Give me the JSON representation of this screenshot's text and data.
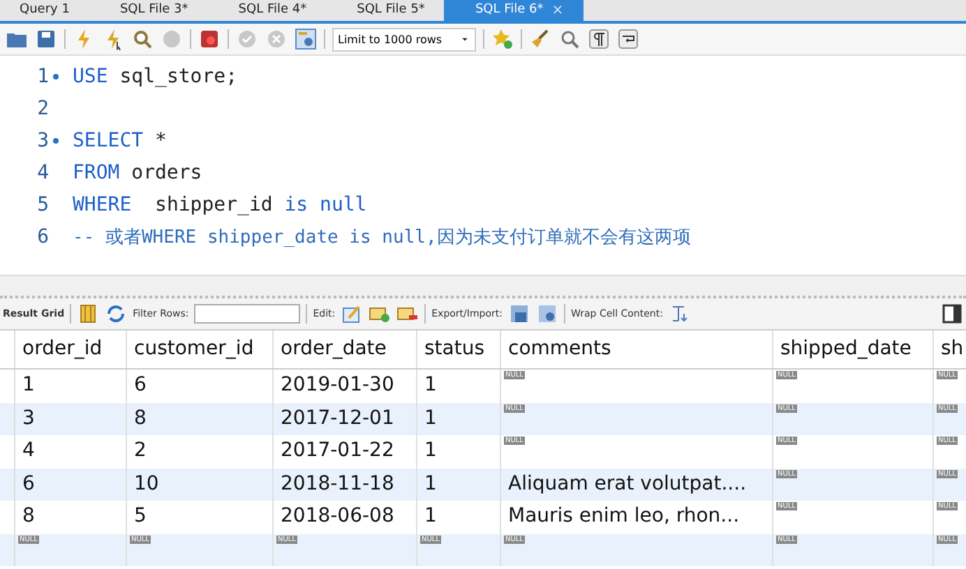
{
  "tabs": [
    {
      "label": "Query 1",
      "selected": false
    },
    {
      "label": "SQL File 3*",
      "selected": false
    },
    {
      "label": "SQL File 4*",
      "selected": false
    },
    {
      "label": "SQL File 5*",
      "selected": false
    },
    {
      "label": "SQL File 6*",
      "selected": true,
      "close": "×"
    }
  ],
  "toolbar": {
    "limit": "Limit to 1000 rows"
  },
  "editor": {
    "lines": [
      {
        "number": "1",
        "fold": true,
        "tokens": [
          {
            "kind": "keyword",
            "text": "USE"
          },
          {
            "kind": "plain",
            "text": " sql_store;"
          }
        ]
      },
      {
        "number": "2",
        "fold": false
      },
      {
        "number": "3",
        "fold": true,
        "tokens": [
          {
            "kind": "keyword",
            "text": "SELECT"
          },
          {
            "kind": "plain",
            "text": " *"
          }
        ]
      },
      {
        "number": "4",
        "fold": false,
        "tokens": [
          {
            "kind": "keyword",
            "text": "FROM"
          },
          {
            "kind": "plain",
            "text": " orders"
          }
        ]
      },
      {
        "number": "5",
        "fold": false,
        "tokens": [
          {
            "kind": "keyword",
            "text": "WHERE"
          },
          {
            "kind": "plain",
            "text": "  shipper_id "
          },
          {
            "kind": "keyword",
            "text": "is null"
          }
        ]
      },
      {
        "number": "6",
        "fold": false,
        "tokens": [
          {
            "kind": "comment",
            "text": "-- 或者WHERE shipper_date is null,因为未支付订单就不会有这两项"
          }
        ]
      }
    ]
  },
  "result_toolbar": {
    "result_grid": "Result Grid",
    "filter_label": "Filter Rows:",
    "edit_label": "Edit:",
    "export_label": "Export/Import:",
    "wrap_label": "Wrap Cell Content:"
  },
  "table": {
    "columns": [
      "order_id",
      "customer_id",
      "order_date",
      "status",
      "comments",
      "shipped_date",
      "sh"
    ],
    "rows": [
      {
        "cells": [
          {
            "kind": "value",
            "text": "1"
          },
          {
            "kind": "value",
            "text": "6"
          },
          {
            "kind": "value",
            "text": "2019-01-30"
          },
          {
            "kind": "value",
            "text": "1"
          },
          {
            "kind": "null",
            "text": "NULL"
          },
          {
            "kind": "null",
            "text": "NULL"
          },
          {
            "kind": "null",
            "text": "NULL"
          }
        ]
      },
      {
        "cells": [
          {
            "kind": "value",
            "text": "3"
          },
          {
            "kind": "value",
            "text": "8"
          },
          {
            "kind": "value",
            "text": "2017-12-01"
          },
          {
            "kind": "value",
            "text": "1"
          },
          {
            "kind": "null",
            "text": "NULL"
          },
          {
            "kind": "null",
            "text": "NULL"
          },
          {
            "kind": "null",
            "text": "NULL"
          }
        ]
      },
      {
        "cells": [
          {
            "kind": "value",
            "text": "4"
          },
          {
            "kind": "value",
            "text": "2"
          },
          {
            "kind": "value",
            "text": "2017-01-22"
          },
          {
            "kind": "value",
            "text": "1"
          },
          {
            "kind": "null",
            "text": "NULL"
          },
          {
            "kind": "null",
            "text": "NULL"
          },
          {
            "kind": "null",
            "text": "NULL"
          }
        ]
      },
      {
        "cells": [
          {
            "kind": "value",
            "text": "6"
          },
          {
            "kind": "value",
            "text": "10"
          },
          {
            "kind": "value",
            "text": "2018-11-18"
          },
          {
            "kind": "value",
            "text": "1"
          },
          {
            "kind": "value",
            "text": "Aliquam erat volutpat...."
          },
          {
            "kind": "null",
            "text": "NULL"
          },
          {
            "kind": "null",
            "text": "NULL"
          }
        ]
      },
      {
        "cells": [
          {
            "kind": "value",
            "text": "8"
          },
          {
            "kind": "value",
            "text": "5"
          },
          {
            "kind": "value",
            "text": "2018-06-08"
          },
          {
            "kind": "value",
            "text": "1"
          },
          {
            "kind": "value",
            "text": "Mauris enim leo, rhon..."
          },
          {
            "kind": "null",
            "text": "NULL"
          },
          {
            "kind": "null",
            "text": "NULL"
          }
        ]
      },
      {
        "cells": [
          {
            "kind": "null",
            "text": "NULL"
          },
          {
            "kind": "null",
            "text": "NULL"
          },
          {
            "kind": "null",
            "text": "NULL"
          },
          {
            "kind": "null",
            "text": "NULL"
          },
          {
            "kind": "null",
            "text": "NULL"
          },
          {
            "kind": "null",
            "text": "NULL"
          },
          {
            "kind": "null",
            "text": "NULL"
          }
        ]
      }
    ]
  }
}
